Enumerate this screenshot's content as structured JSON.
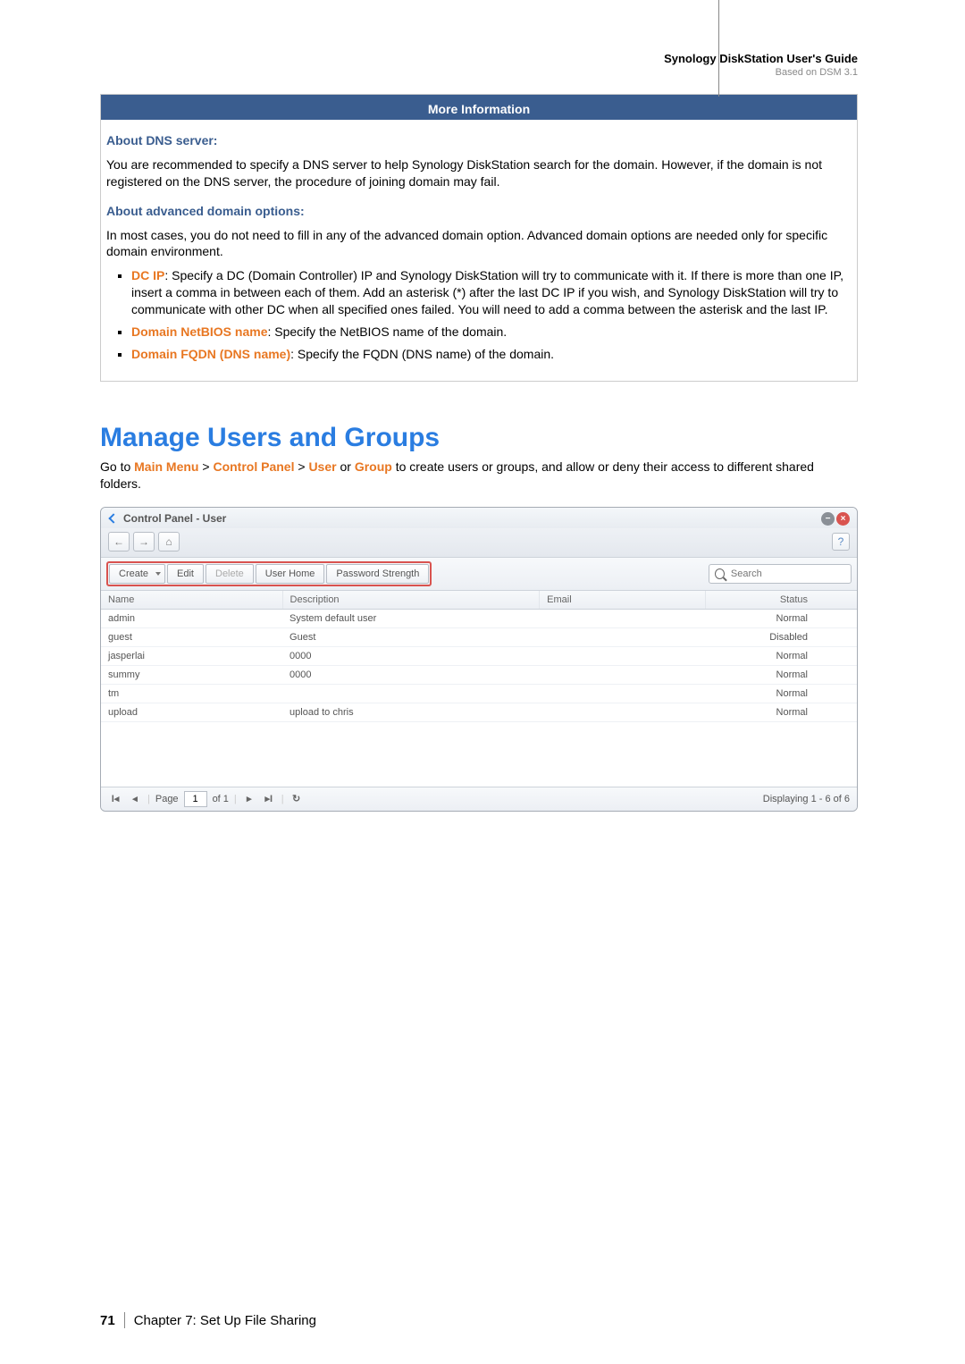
{
  "header": {
    "guide_title": "Synology DiskStation User's Guide",
    "guide_sub": "Based on DSM 3.1"
  },
  "info_box": {
    "title": "More Information",
    "dns_title": "About DNS server:",
    "dns_body": "You are recommended to specify a DNS server to help Synology DiskStation search for the domain. However, if the domain is not registered on the DNS server, the procedure of joining domain may fail.",
    "adv_title": "About advanced domain options:",
    "adv_body": "In most cases, you do not need to fill in any of the advanced domain option. Advanced domain options are needed only for specific domain environment.",
    "bullets": [
      {
        "label": "DC IP",
        "text": ": Specify a DC (Domain Controller) IP and Synology DiskStation will try to communicate with it. If there is more than one IP, insert a comma in between each of them. Add an asterisk (*) after the last DC IP if you wish, and Synology DiskStation will try to communicate with other DC when all specified ones failed. You will need to add a comma between the asterisk and the last IP."
      },
      {
        "label": "Domain NetBIOS name",
        "text": ": Specify the NetBIOS name of the domain."
      },
      {
        "label": "Domain FQDN (DNS name)",
        "text": ": Specify the FQDN (DNS name) of the domain."
      }
    ]
  },
  "section": {
    "title": "Manage Users and Groups",
    "body_pre": "Go to ",
    "breadcrumb": [
      "Main Menu",
      "Control Panel",
      "User",
      "Group"
    ],
    "body_mid": " or ",
    "body_post": " to create users or groups, and allow or deny their access to different shared folders."
  },
  "screenshot": {
    "title": "Control Panel - User",
    "toolbar": {
      "create": "Create",
      "edit": "Edit",
      "delete": "Delete",
      "user_home": "User Home",
      "password_strength": "Password Strength",
      "search_placeholder": "Search"
    },
    "columns": [
      "Name",
      "Description",
      "Email",
      "Status"
    ],
    "rows": [
      {
        "name": "admin",
        "desc": "System default user",
        "email": "",
        "status": "Normal"
      },
      {
        "name": "guest",
        "desc": "Guest",
        "email": "",
        "status": "Disabled"
      },
      {
        "name": "jasperlai",
        "desc": "0000",
        "email": "",
        "status": "Normal"
      },
      {
        "name": "summy",
        "desc": "0000",
        "email": "",
        "status": "Normal"
      },
      {
        "name": "tm",
        "desc": "",
        "email": "",
        "status": "Normal"
      },
      {
        "name": "upload",
        "desc": "upload to chris",
        "email": "",
        "status": "Normal"
      }
    ],
    "pager": {
      "page_label": "Page",
      "page_value": "1",
      "of": "of 1",
      "display": "Displaying 1 - 6 of 6"
    }
  },
  "footer": {
    "page_num": "71",
    "chapter": "Chapter 7: Set Up File Sharing"
  }
}
